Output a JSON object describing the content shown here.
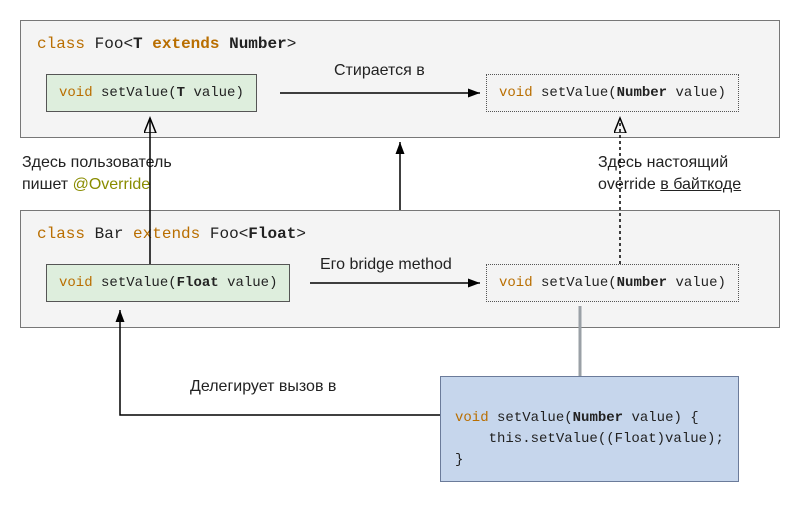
{
  "foo": {
    "decl_prefix": "class",
    "decl_name": "Foo",
    "decl_generic_open": "<",
    "decl_bound_kw": "extends",
    "decl_type_param": "T",
    "decl_bound_type": "Number",
    "decl_generic_close": ">",
    "method_src": {
      "ret": "void",
      "name": "setValue",
      "arg_type": "T",
      "arg_name": "value"
    },
    "method_erased": {
      "ret": "void",
      "name": "setValue",
      "arg_type": "Number",
      "arg_name": "value"
    }
  },
  "bar": {
    "decl_prefix": "class",
    "decl_name": "Bar",
    "decl_kw": "extends",
    "decl_super": "Foo",
    "decl_super_generic": "Float",
    "method_src": {
      "ret": "void",
      "name": "setValue",
      "arg_type": "Float",
      "arg_name": "value"
    },
    "method_erased": {
      "ret": "void",
      "name": "setValue",
      "arg_type": "Number",
      "arg_name": "value"
    }
  },
  "bridge": {
    "line1_ret": "void",
    "line1_name": "setValue",
    "line1_arg_type": "Number",
    "line1_arg_name": "value",
    "line1_open": " {",
    "line2": "    this.setValue((Float)value);",
    "line3": "}"
  },
  "labels": {
    "erased_in": "Стирается в",
    "user_override_1": "Здесь пользователь",
    "user_override_2": "пишет ",
    "user_override_ann": "@Override",
    "bridge_method": "Его bridge method",
    "real_override_1": "Здесь настоящий",
    "real_override_2_a": "override ",
    "real_override_2_b": "в байткоде",
    "delegates": "Делегирует вызов в"
  }
}
